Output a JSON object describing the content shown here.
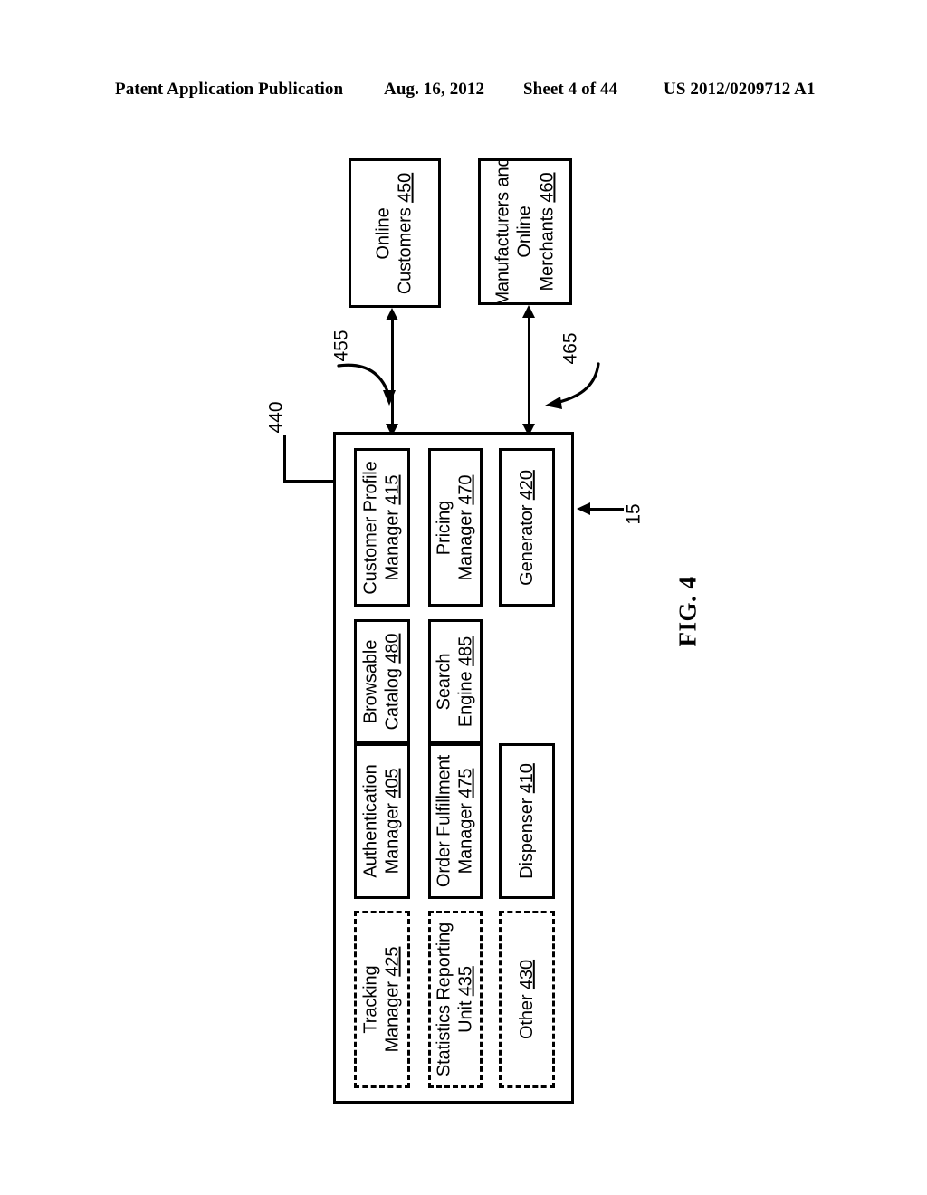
{
  "header": {
    "publication": "Patent Application Publication",
    "date": "Aug. 16, 2012",
    "sheet": "Sheet 4 of 44",
    "pub_number": "US 2012/0209712 A1"
  },
  "figure": {
    "caption": "FIG. 4"
  },
  "external_entities": [
    {
      "name": "online-customers",
      "lines": [
        "Online",
        "Customers"
      ],
      "ref": "450"
    },
    {
      "name": "manufacturers-and-online-merchants",
      "lines": [
        "Manufacturers and",
        "Online",
        "Merchants"
      ],
      "ref": "460"
    }
  ],
  "platform": {
    "ref": "440",
    "system_ref": "15",
    "components": [
      {
        "name": "customer-profile-manager",
        "lines": [
          "Customer Profile",
          "Manager"
        ],
        "ref": "415",
        "style": "solid"
      },
      {
        "name": "browsable-catalog",
        "lines": [
          "Browsable",
          "Catalog"
        ],
        "ref": "480",
        "style": "solid"
      },
      {
        "name": "authentication-manager",
        "lines": [
          "Authentication",
          "Manager"
        ],
        "ref": "405",
        "style": "solid"
      },
      {
        "name": "tracking-manager",
        "lines": [
          "Tracking",
          "Manager"
        ],
        "ref": "425",
        "style": "dashed"
      },
      {
        "name": "pricing-manager",
        "lines": [
          "Pricing",
          "Manager"
        ],
        "ref": "470",
        "style": "solid"
      },
      {
        "name": "search-engine",
        "lines": [
          "Search",
          "Engine"
        ],
        "ref": "485",
        "style": "solid"
      },
      {
        "name": "order-fulfillment-manager",
        "lines": [
          "Order Fulfillment",
          "Manager"
        ],
        "ref": "475",
        "style": "solid"
      },
      {
        "name": "statistics-reporting-unit",
        "lines": [
          "Statistics Reporting",
          "Unit"
        ],
        "ref": "435",
        "style": "dashed"
      },
      {
        "name": "generator",
        "lines": [
          "Generator"
        ],
        "ref": "420",
        "style": "solid"
      },
      {
        "name": "dispenser",
        "lines": [
          "Dispenser"
        ],
        "ref": "410",
        "style": "solid"
      },
      {
        "name": "other",
        "lines": [
          "Other"
        ],
        "ref": "430",
        "style": "dashed"
      }
    ]
  },
  "connectors": [
    {
      "name": "customers-link",
      "ref": "455"
    },
    {
      "name": "merchants-link",
      "ref": "465"
    }
  ]
}
